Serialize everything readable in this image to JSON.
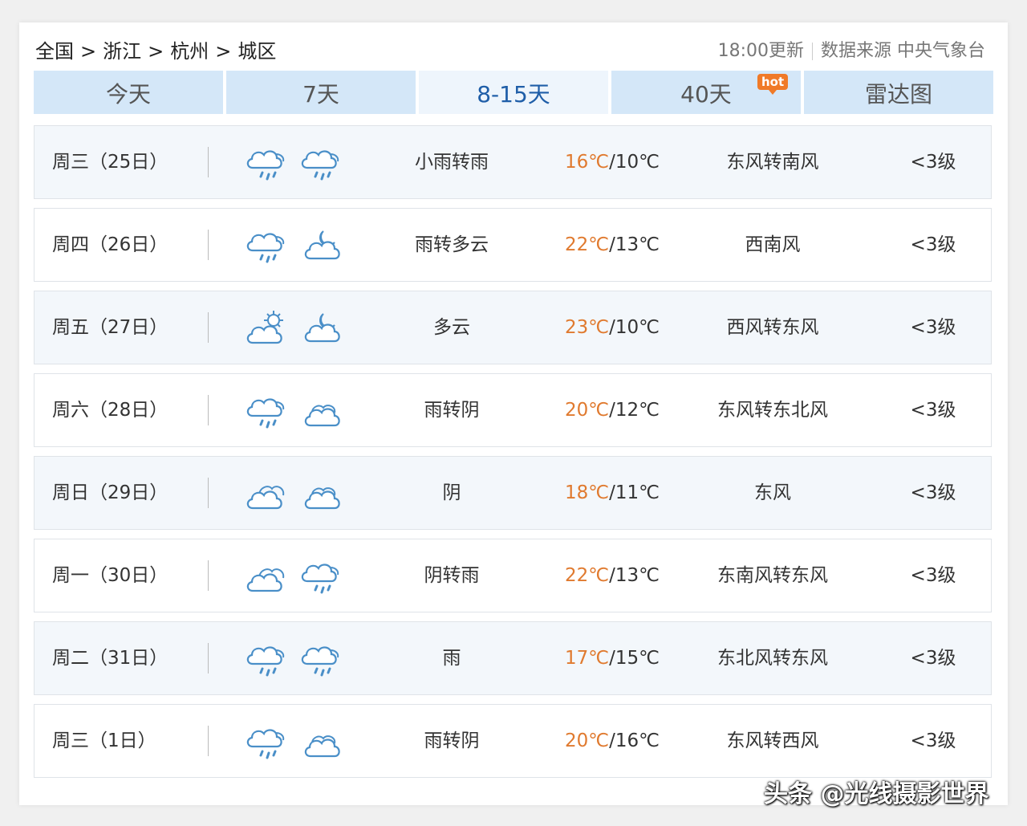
{
  "breadcrumb": [
    "全国",
    "浙江",
    "杭州",
    "城区"
  ],
  "breadcrumb_sep": ">",
  "update_time": "18:00更新",
  "source": "数据来源 中央气象台",
  "tabs": [
    {
      "label": "今天",
      "active": false
    },
    {
      "label": "7天",
      "active": false
    },
    {
      "label": "8-15天",
      "active": true
    },
    {
      "label": "40天",
      "active": false,
      "badge": "hot"
    },
    {
      "label": "雷达图",
      "active": false
    }
  ],
  "forecast": [
    {
      "date": "周三（25日）",
      "icons": [
        "rain-cloud-icon",
        "rain-cloud-icon"
      ],
      "desc": "小雨转雨",
      "high": "16℃",
      "low": "10℃",
      "wind": "东风转南风",
      "level": "<3级"
    },
    {
      "date": "周四（26日）",
      "icons": [
        "rain-cloud-icon",
        "cloud-moon-icon"
      ],
      "desc": "雨转多云",
      "high": "22℃",
      "low": "13℃",
      "wind": "西南风",
      "level": "<3级"
    },
    {
      "date": "周五（27日）",
      "icons": [
        "cloud-sun-icon",
        "cloud-moon-icon"
      ],
      "desc": "多云",
      "high": "23℃",
      "low": "10℃",
      "wind": "西风转东风",
      "level": "<3级"
    },
    {
      "date": "周六（28日）",
      "icons": [
        "rain-cloud-icon",
        "overcast-moon-icon"
      ],
      "desc": "雨转阴",
      "high": "20℃",
      "low": "12℃",
      "wind": "东风转东北风",
      "level": "<3级"
    },
    {
      "date": "周日（29日）",
      "icons": [
        "overcast-icon",
        "overcast-moon-icon"
      ],
      "desc": "阴",
      "high": "18℃",
      "low": "11℃",
      "wind": "东风",
      "level": "<3级"
    },
    {
      "date": "周一（30日）",
      "icons": [
        "overcast-icon",
        "rain-cloud-icon"
      ],
      "desc": "阴转雨",
      "high": "22℃",
      "low": "13℃",
      "wind": "东南风转东风",
      "level": "<3级"
    },
    {
      "date": "周二（31日）",
      "icons": [
        "rain-cloud-icon",
        "rain-cloud-icon"
      ],
      "desc": "雨",
      "high": "17℃",
      "low": "15℃",
      "wind": "东北风转东风",
      "level": "<3级"
    },
    {
      "date": "周三（1日）",
      "icons": [
        "rain-cloud-icon",
        "overcast-moon-icon"
      ],
      "desc": "雨转阴",
      "high": "20℃",
      "low": "16℃",
      "wind": "东风转西风",
      "level": "<3级"
    }
  ],
  "watermark": "头条 @光线摄影世界",
  "colors": {
    "accent": "#1f5ea8",
    "high_temp": "#e07a2f",
    "tab_bg": "#d4e7f8",
    "icon_stroke": "#4a8fc8"
  }
}
